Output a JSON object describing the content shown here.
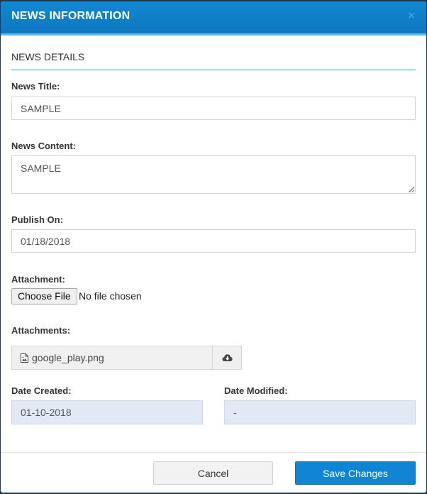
{
  "modal": {
    "title": "NEWS INFORMATION",
    "close_icon": "close-icon",
    "close_glyph": "×",
    "section_title": "NEWS DETAILS"
  },
  "form": {
    "news_title": {
      "label": "News Title:",
      "value": "SAMPLE"
    },
    "news_content": {
      "label": "News Content:",
      "value": "SAMPLE"
    },
    "publish_on": {
      "label": "Publish On:",
      "value": "01/18/2018"
    },
    "attachment": {
      "label": "Attachment:",
      "button_label": "Choose File",
      "status": "No file chosen"
    },
    "attachments": {
      "label": "Attachments:",
      "file_name": "google_play.png",
      "file_icon": "image-file-icon",
      "download_icon": "cloud-download-icon"
    },
    "date_created": {
      "label": "Date Created:",
      "value": "01-10-2018"
    },
    "date_modified": {
      "label": "Date Modified:",
      "value": "-"
    }
  },
  "footer": {
    "cancel_label": "Cancel",
    "save_label": "Save Changes"
  },
  "colors": {
    "header": "#0c7fc8",
    "primary_button": "#1185d3",
    "readonly_field": "#e0e9f4"
  }
}
